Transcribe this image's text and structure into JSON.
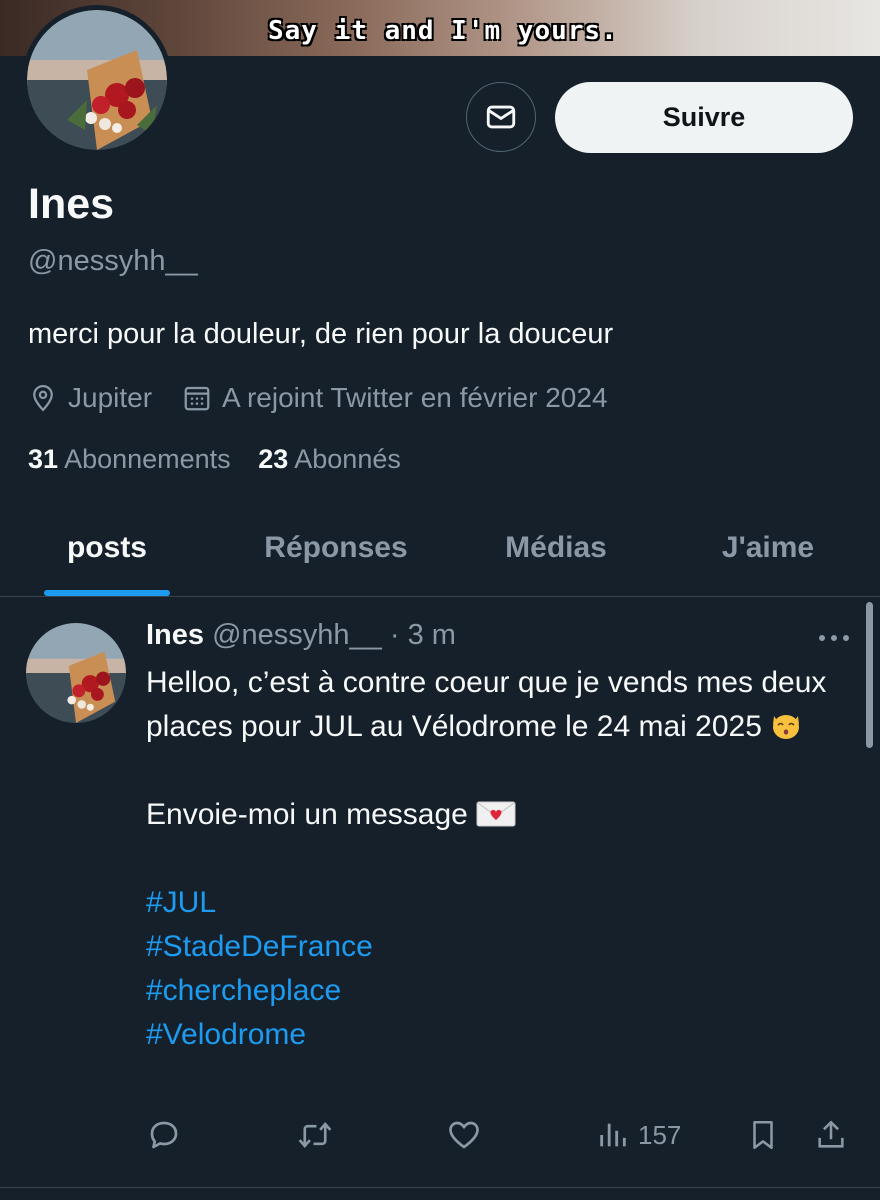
{
  "banner": {
    "caption": "Say it and I'm yours."
  },
  "profile": {
    "display_name": "Ines",
    "handle": "@nessyhh__",
    "bio": "merci pour la douleur, de rien pour la douceur",
    "location": "Jupiter",
    "joined": "A rejoint Twitter en février 2024",
    "following_count": "31",
    "following_label": "Abonnements",
    "followers_count": "23",
    "followers_label": "Abonnés"
  },
  "actions": {
    "follow_label": "Suivre"
  },
  "tabs": [
    {
      "label": "posts",
      "active": true
    },
    {
      "label": "Réponses",
      "active": false
    },
    {
      "label": "Médias",
      "active": false
    },
    {
      "label": "J'aime",
      "active": false
    }
  ],
  "post": {
    "author": "Ines",
    "handle": "@nessyhh__",
    "separator": "·",
    "time": "3 m",
    "line1": "Helloo, c’est à contre coeur que je vends mes deux places pour JUL au Vélodrome le 24 mai 2025",
    "line2": "Envoie-moi un message",
    "hashtags": [
      "#JUL",
      "#StadeDeFrance",
      "#chercheplace",
      "#Velodrome"
    ],
    "views": "157"
  },
  "icons": {
    "message": "envelope-icon",
    "location": "location-pin-icon",
    "calendar": "calendar-icon",
    "more": "more-dots-icon",
    "reply": "reply-icon",
    "retweet": "retweet-icon",
    "like": "heart-icon",
    "views": "views-chart-icon",
    "bookmark": "bookmark-icon",
    "share": "share-icon"
  },
  "colors": {
    "background": "#15202b",
    "accent": "#1d9bf0",
    "text_secondary": "#8b98a5",
    "follow_button": "#eff3f4"
  }
}
